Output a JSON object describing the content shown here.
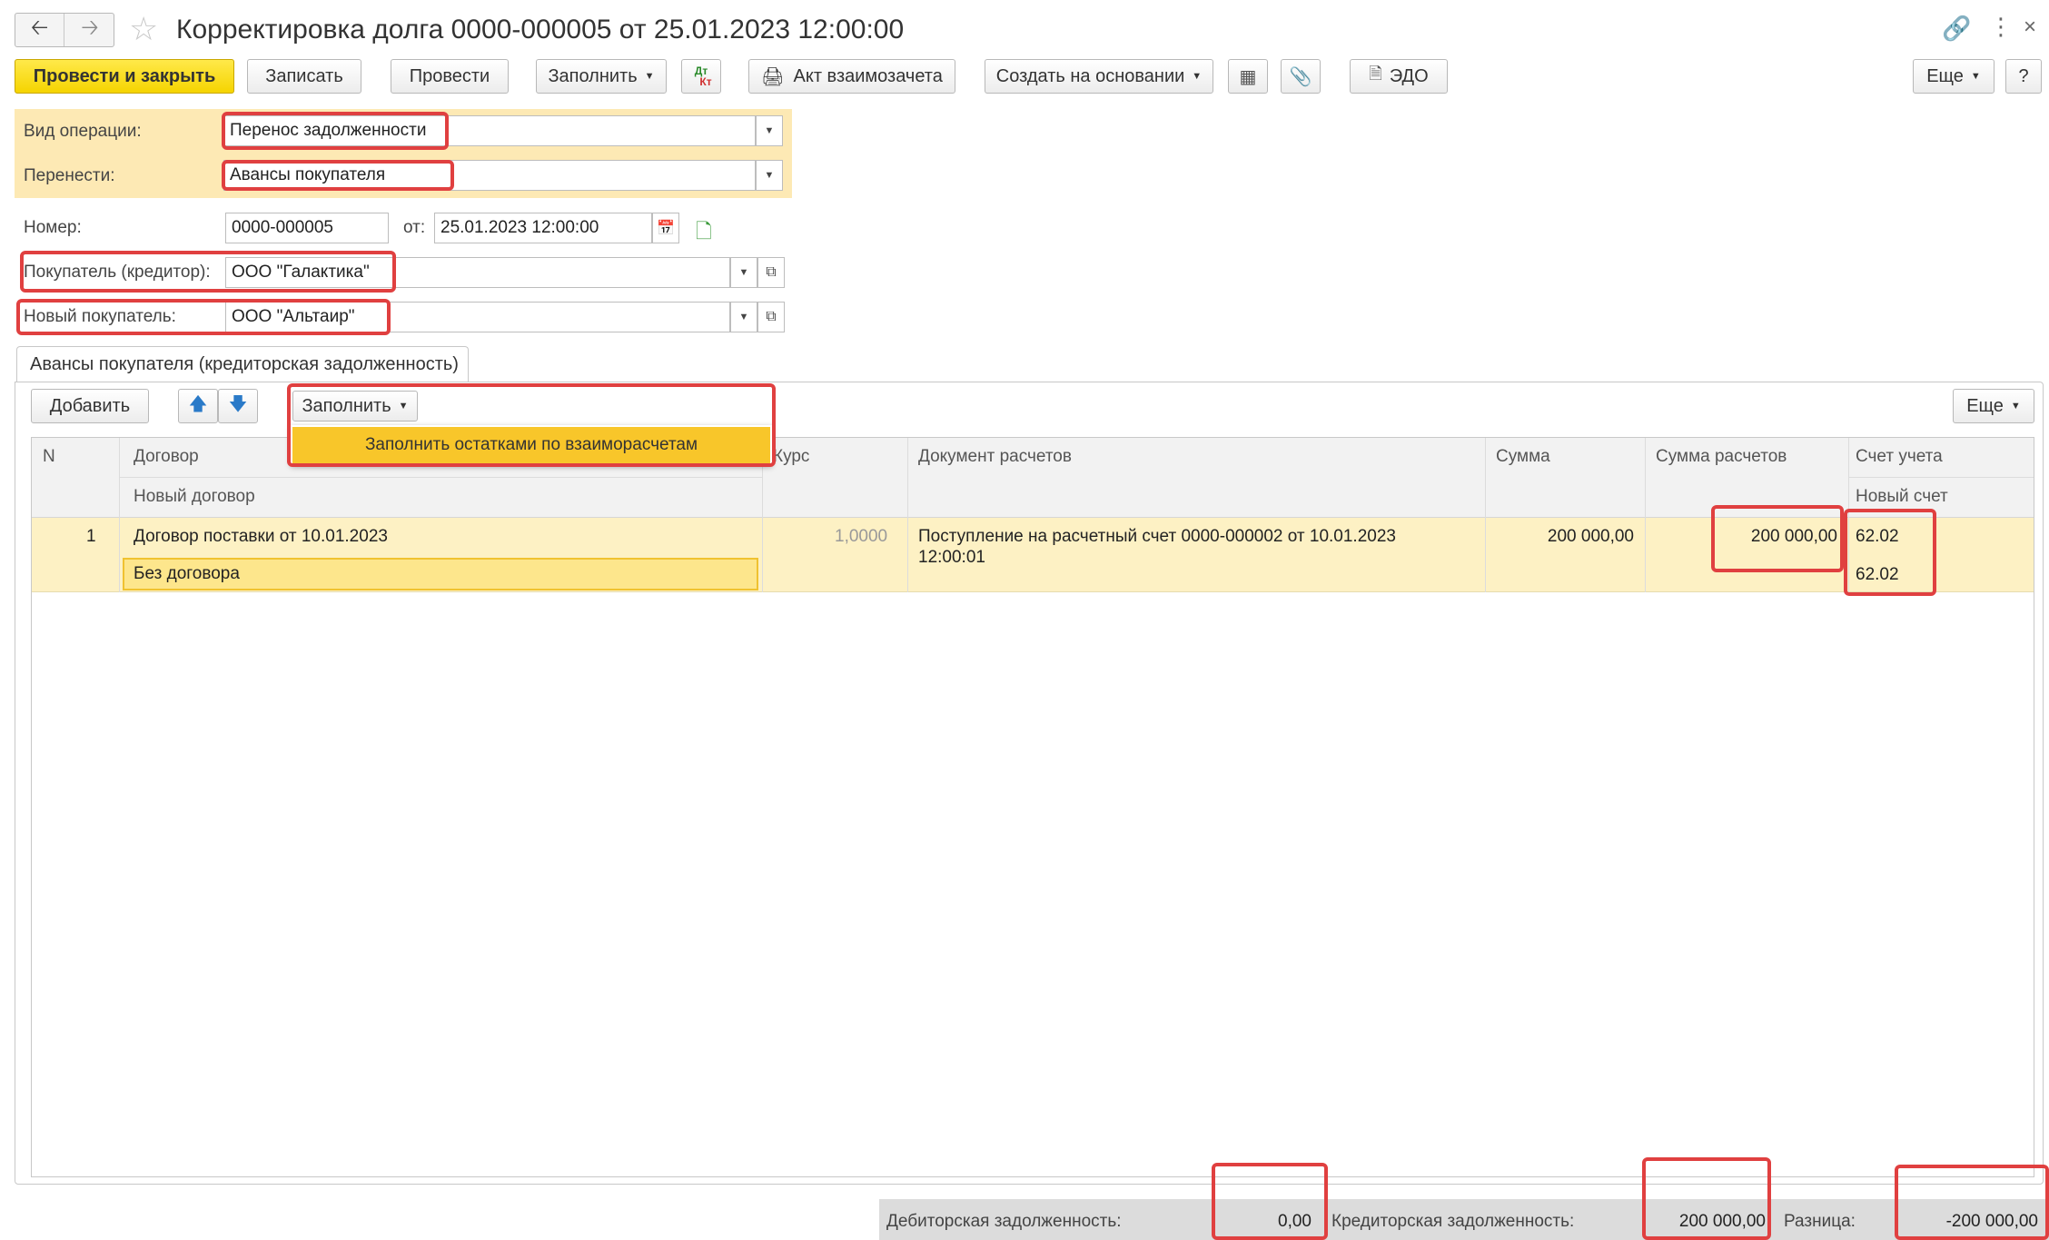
{
  "window": {
    "title": "Корректировка долга 0000-000005 от 25.01.2023 12:00:00"
  },
  "toolbar": {
    "post_close": "Провести и закрыть",
    "save": "Записать",
    "post": "Провести",
    "fill": "Заполнить",
    "dtkt_top": "Дт",
    "dtkt_bottom": "Кт",
    "act": "Акт взаимозачета",
    "create_based": "Создать на основании",
    "edo": "ЭДО",
    "more": "Еще",
    "help": "?"
  },
  "form": {
    "operation_label": "Вид операции:",
    "operation_value": "Перенос задолженности",
    "transfer_label": "Перенести:",
    "transfer_value": "Авансы покупателя",
    "number_label": "Номер:",
    "number_value": "0000-000005",
    "date_label": "от:",
    "date_value": "25.01.2023 12:00:00",
    "buyer_label": "Покупатель (кредитор):",
    "buyer_value": "ООО \"Галактика\"",
    "new_buyer_label": "Новый покупатель:",
    "new_buyer_value": "ООО \"Альтаир\""
  },
  "tab": {
    "label": "Авансы покупателя (кредиторская задолженность)"
  },
  "table_toolbar": {
    "add": "Добавить",
    "fill": "Заполнить",
    "more": "Еще",
    "fill_menu_item": "Заполнить остатками по взаиморасчетам"
  },
  "table": {
    "headers": {
      "n": "N",
      "contract": "Договор",
      "new_contract": "Новый договор",
      "rate": "Курс",
      "doc": "Документ расчетов",
      "sum": "Сумма",
      "settle_sum": "Сумма расчетов",
      "account": "Счет учета",
      "new_account": "Новый счет"
    },
    "rows": [
      {
        "n": "1",
        "contract": "Договор поставки от 10.01.2023",
        "new_contract": "Без договора",
        "rate": "1,0000",
        "doc_line1": "Поступление на расчетный счет 0000-000002 от 10.01.2023",
        "doc_line2": "12:00:01",
        "sum": "200 000,00",
        "settle_sum": "200 000,00",
        "account": "62.02",
        "new_account": "62.02"
      }
    ]
  },
  "footer": {
    "debit_label": "Дебиторская задолженность:",
    "debit_value": "0,00",
    "credit_label": "Кредиторская задолженность:",
    "credit_value": "200 000,00",
    "diff_label": "Разница:",
    "diff_value": "-200 000,00"
  },
  "colors": {
    "accent_yellow": "#f5d400",
    "highlight_bg": "#fdf0c0",
    "annotation_red": "#e04040"
  }
}
